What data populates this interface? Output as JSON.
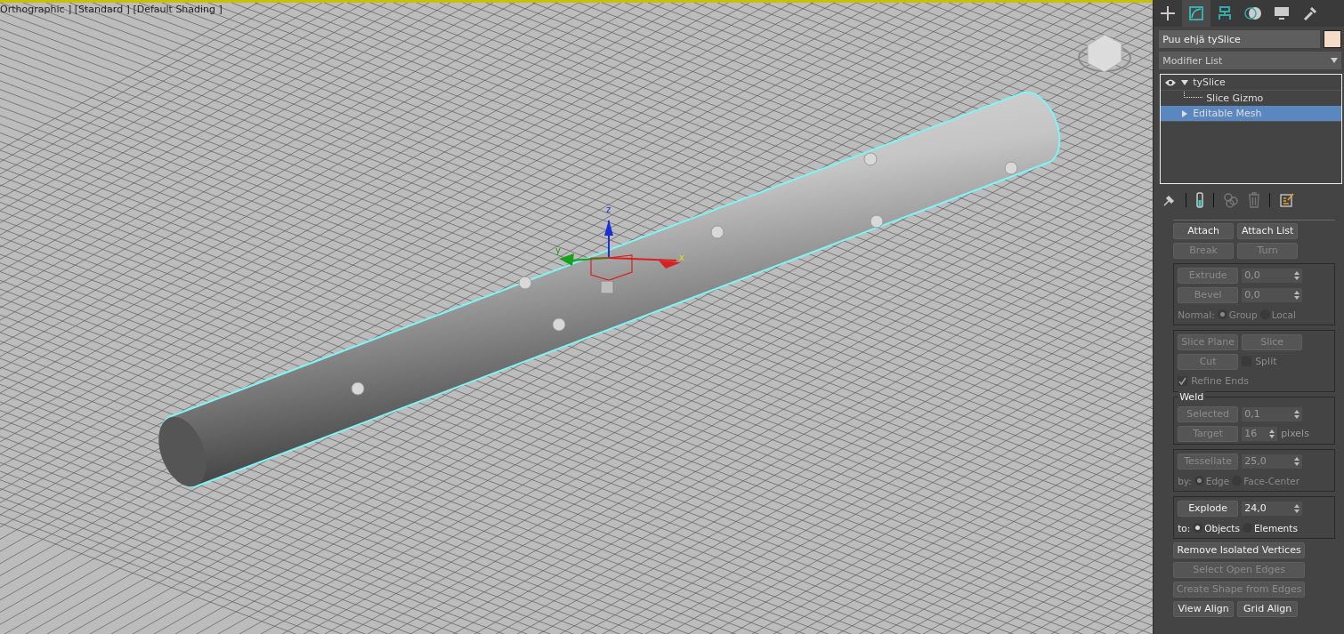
{
  "viewport": {
    "label": "Orthographic ] [Standard ] [Default Shading ]",
    "active": true,
    "axes": [
      {
        "label": "z"
      },
      {
        "label": "y"
      },
      {
        "label": "x"
      }
    ]
  },
  "command_panel": {
    "tabs": [
      {
        "selected": false
      },
      {
        "selected": true
      },
      {
        "selected": false
      },
      {
        "selected": false
      },
      {
        "selected": false
      },
      {
        "selected": false
      }
    ]
  },
  "object": {
    "name": "Puu ehjä tySlice",
    "color": "#f4dcc8"
  },
  "modifier_list": {
    "label": "Modifier List"
  },
  "stack": [
    {
      "label": "tySlice",
      "visible": true,
      "expanded": true,
      "selected": false,
      "children": [
        {
          "label": "Slice Gizmo",
          "selected": false
        }
      ]
    },
    {
      "label": "Editable Mesh",
      "expanded": false,
      "selected": true
    }
  ],
  "sections": [
    {
      "framed": false,
      "rows": [
        {
          "kind": "buttons",
          "items": [
            {
              "label": "Attach",
              "disabled": false
            },
            {
              "label": "Attach List",
              "disabled": false
            }
          ]
        },
        {
          "kind": "buttons",
          "items": [
            {
              "label": "Break",
              "disabled": true
            },
            {
              "label": "Turn",
              "disabled": true
            }
          ]
        }
      ]
    },
    {
      "framed": true,
      "rows": [
        {
          "kind": "spinner",
          "label": "Extrude",
          "value": "0,0",
          "disabled": true
        },
        {
          "kind": "spinner",
          "label": "Bevel",
          "value": "0,0",
          "disabled": true
        },
        {
          "kind": "radios",
          "label": "Normal:",
          "disabled": true,
          "options": [
            {
              "label": "Group",
              "selected": true
            },
            {
              "label": "Local",
              "selected": false
            }
          ]
        }
      ]
    },
    {
      "framed": true,
      "rows": [
        {
          "kind": "buttons",
          "items": [
            {
              "label": "Slice Plane",
              "disabled": true
            },
            {
              "label": "Slice",
              "disabled": true
            }
          ]
        },
        {
          "kind": "button_check",
          "label": "Cut",
          "disabled": true,
          "check": {
            "label": "Split",
            "checked": false
          }
        },
        {
          "kind": "checkbox",
          "label": "Refine Ends",
          "checked": true,
          "disabled": true
        }
      ]
    },
    {
      "framed": true,
      "title": "Weld",
      "rows": [
        {
          "kind": "spinner",
          "label": "Selected",
          "value": "0,1",
          "disabled": true
        },
        {
          "kind": "spinner",
          "label": "Target",
          "value": "16",
          "suffix": "pixels",
          "disabled": true
        }
      ]
    },
    {
      "framed": true,
      "rows": [
        {
          "kind": "spinner",
          "label": "Tessellate",
          "value": "25,0",
          "disabled": true
        },
        {
          "kind": "radios",
          "label": "by:",
          "disabled": true,
          "options": [
            {
              "label": "Edge",
              "selected": true
            },
            {
              "label": "Face-Center",
              "selected": false
            }
          ]
        }
      ]
    },
    {
      "framed": true,
      "rows": [
        {
          "kind": "spinner",
          "label": "Explode",
          "value": "24,0",
          "disabled": false
        },
        {
          "kind": "radios",
          "label": "to:",
          "disabled": false,
          "options": [
            {
              "label": "Objects",
              "selected": true
            },
            {
              "label": "Elements",
              "selected": false
            }
          ]
        }
      ]
    },
    {
      "framed": false,
      "rows": [
        {
          "kind": "wide",
          "label": "Remove Isolated Vertices",
          "disabled": false
        },
        {
          "kind": "wide",
          "label": "Select Open Edges",
          "disabled": true
        },
        {
          "kind": "wide",
          "label": "Create Shape from Edges",
          "disabled": true
        },
        {
          "kind": "buttons",
          "items": [
            {
              "label": "View Align",
              "disabled": false
            },
            {
              "label": "Grid Align",
              "disabled": false
            }
          ]
        }
      ]
    }
  ]
}
